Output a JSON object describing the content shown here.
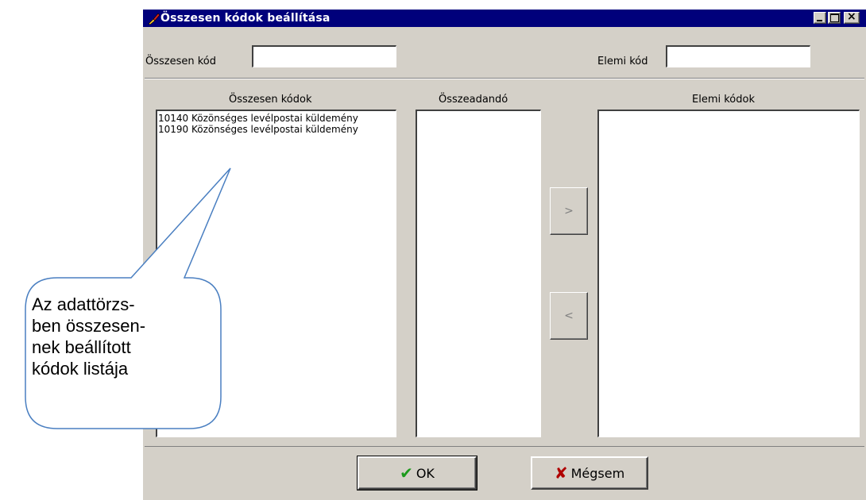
{
  "window": {
    "title": "Összesen kódok beállítása",
    "title_bar_color": "#00007b",
    "icon": "brush-icon"
  },
  "form": {
    "osszesen_kod_label": "Összesen kód",
    "osszesen_kod_value": "",
    "elemi_kod_label": "Elemi kód",
    "elemi_kod_value": ""
  },
  "lists": {
    "osszesen_header": "Összesen kódok",
    "osszesen_items": [
      "10140 Közönséges levélpostai küldemény",
      "10190 Közönséges levélpostai küldemény"
    ],
    "osszeadando_header": "Összeadandó",
    "elemi_header": "Elemi kódok"
  },
  "buttons": {
    "add_label": ">",
    "remove_label": "<",
    "ok_label": "OK",
    "cancel_label": "Mégsem"
  },
  "callout": {
    "text_lines": [
      "Az adattörzs-",
      "ben összesen-",
      "nek beállított",
      "kódok listája"
    ],
    "border_color": "#4a7fc1"
  }
}
